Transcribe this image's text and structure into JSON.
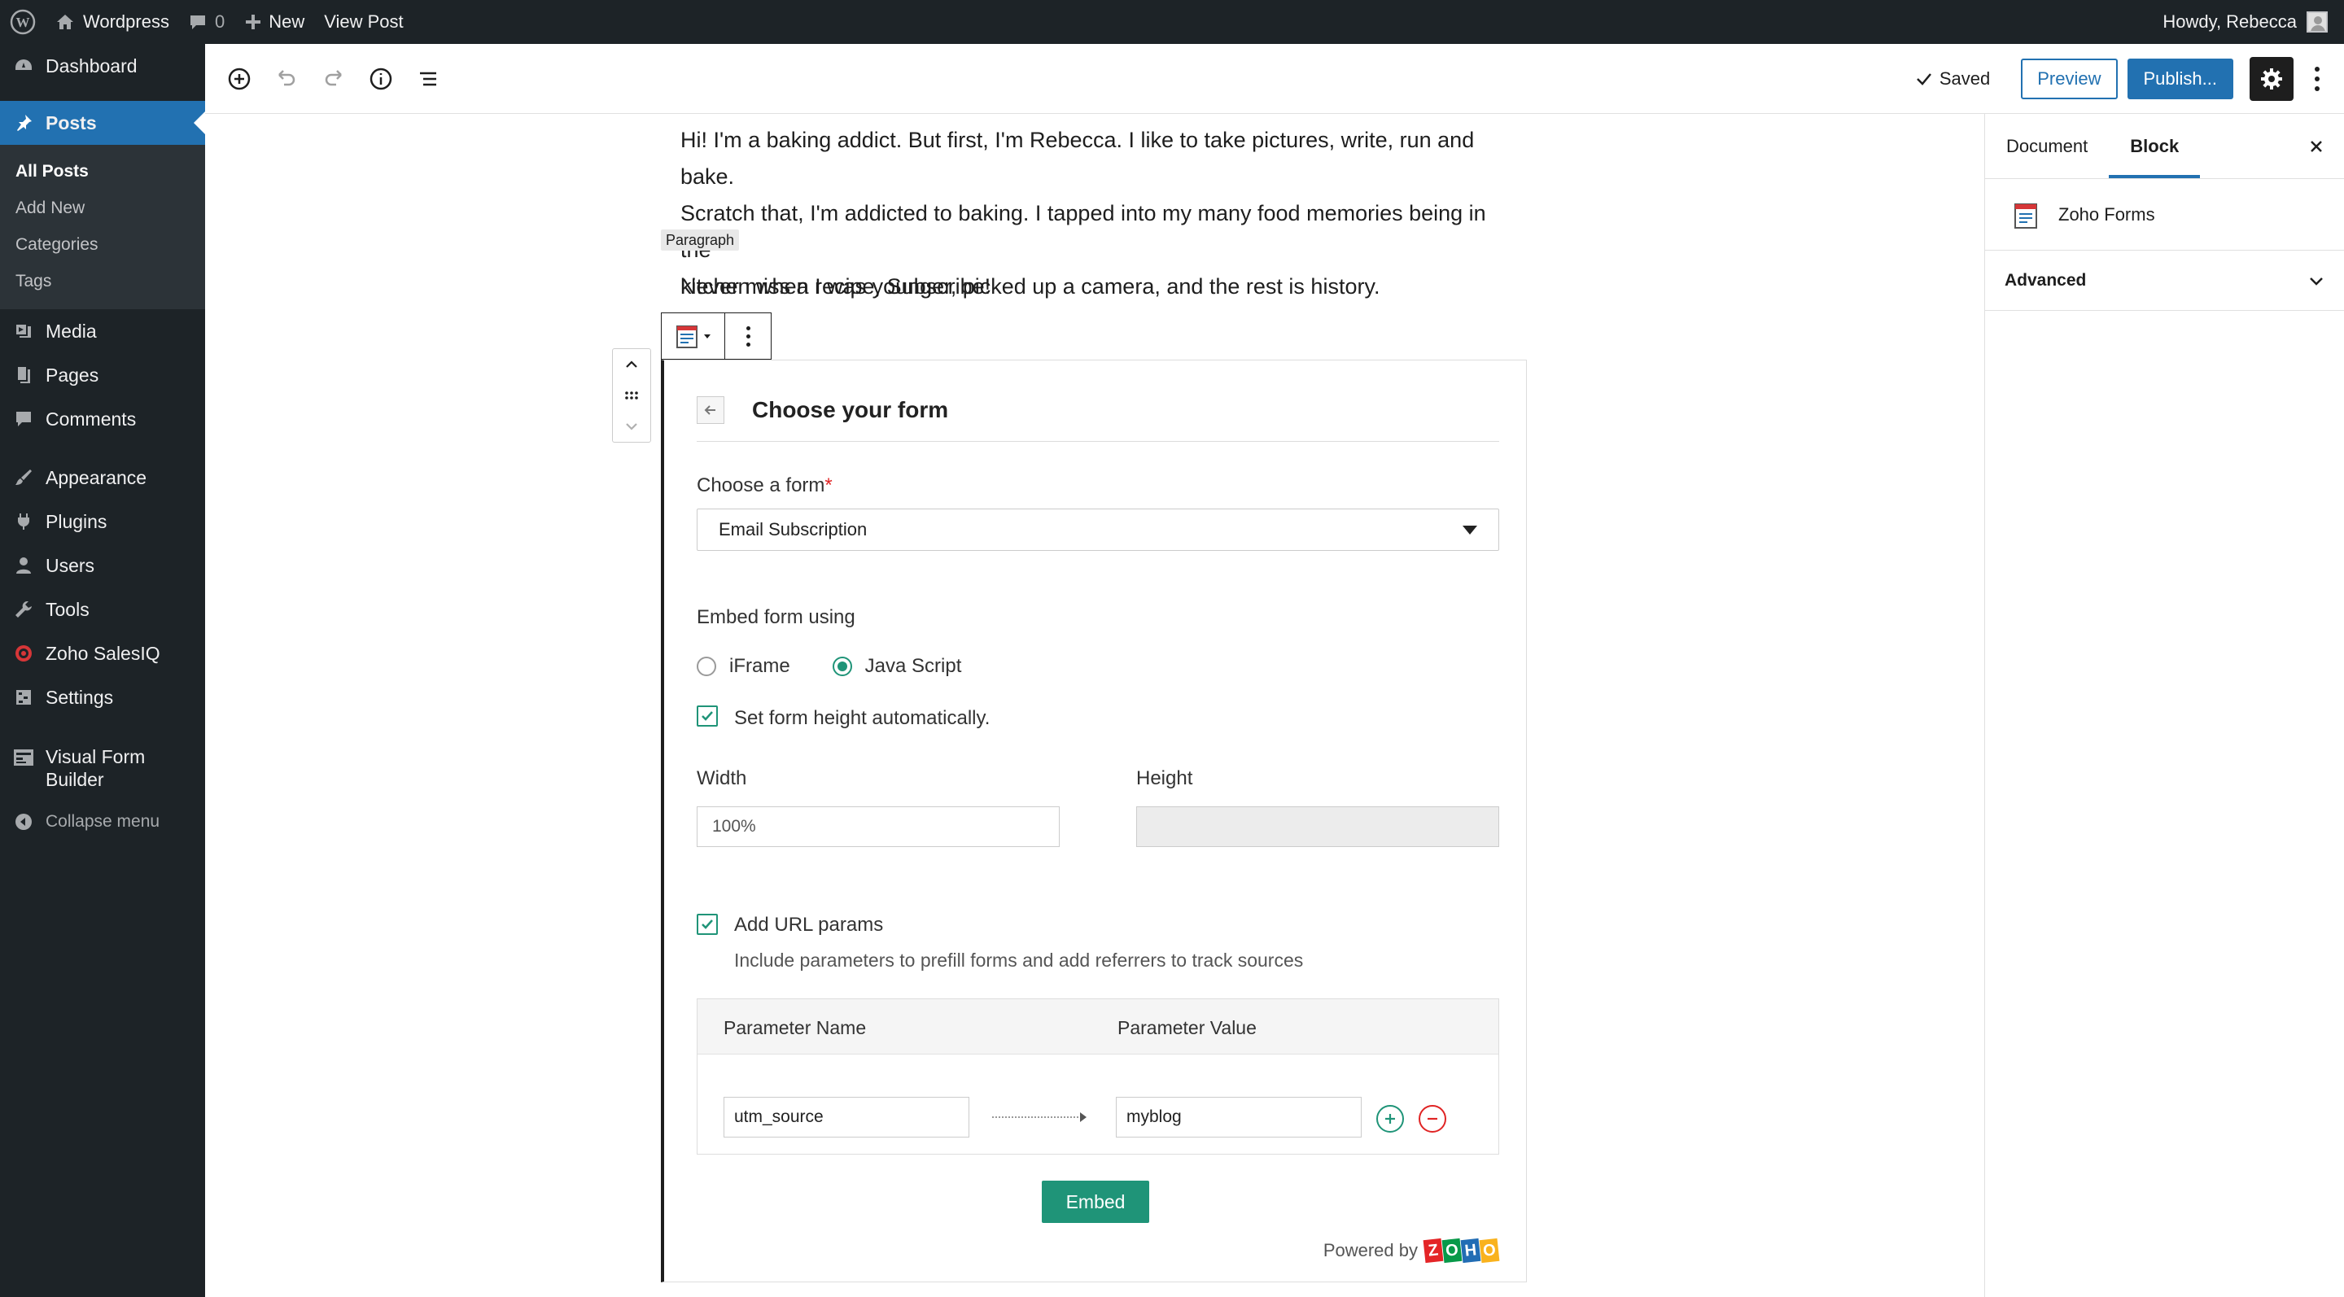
{
  "adminbar": {
    "site_name": "Wordpress",
    "comments_count": "0",
    "new_label": "New",
    "view_post_label": "View Post",
    "howdy": "Howdy, Rebecca"
  },
  "sidebar": {
    "dashboard": "Dashboard",
    "posts": "Posts",
    "posts_submenu": [
      "All Posts",
      "Add New",
      "Categories",
      "Tags"
    ],
    "media": "Media",
    "pages": "Pages",
    "comments": "Comments",
    "appearance": "Appearance",
    "plugins": "Plugins",
    "users": "Users",
    "tools": "Tools",
    "zoho_salesiq": "Zoho SalesIQ",
    "settings": "Settings",
    "visual_form_builder_1": "Visual Form",
    "visual_form_builder_2": "Builder",
    "collapse": "Collapse menu"
  },
  "header": {
    "saved": "Saved",
    "preview": "Preview",
    "publish": "Publish..."
  },
  "settings_panel": {
    "tab_document": "Document",
    "tab_block": "Block",
    "block_name": "Zoho Forms",
    "advanced": "Advanced"
  },
  "content": {
    "para_line_1": "Hi! I'm a baking addict. But first, I'm Rebecca. I like to take pictures, write, run and bake.",
    "para_line_2": "Scratch that, I'm addicted to baking. I tapped into my many food memories being in the",
    "para_line_3": "kitchen when I was younger, picked up a camera, and the rest is history.",
    "block_label": "Paragraph",
    "subscribe_text": "Never miss a recipe, Subscribe!"
  },
  "form": {
    "title": "Choose your form",
    "choose_label": "Choose a form",
    "required_mark": "*",
    "selected_form": "Email Subscription",
    "embed_label": "Embed form using",
    "option_iframe": "iFrame",
    "option_js": "Java Script",
    "auto_height_label": "Set form height automatically.",
    "width_label": "Width",
    "height_label": "Height",
    "width_value": "100%",
    "height_value": "",
    "url_params_label": "Add URL params",
    "url_params_help": "Include parameters to prefill forms and add referrers to track sources",
    "param_name_header": "Parameter Name",
    "param_value_header": "Parameter Value",
    "param_name": "utm_source",
    "param_value": "myblog",
    "embed_button": "Embed",
    "powered_by": "Powered by",
    "logo_letters": [
      "Z",
      "O",
      "H",
      "O"
    ],
    "logo_colors": [
      "#e42527",
      "#089949",
      "#226db4",
      "#f9b21d"
    ]
  },
  "colors": {
    "admin_dark": "#1d2327",
    "accent_blue": "#2271b1",
    "zoho_green": "#1f9478",
    "remove_red": "#e02424"
  }
}
